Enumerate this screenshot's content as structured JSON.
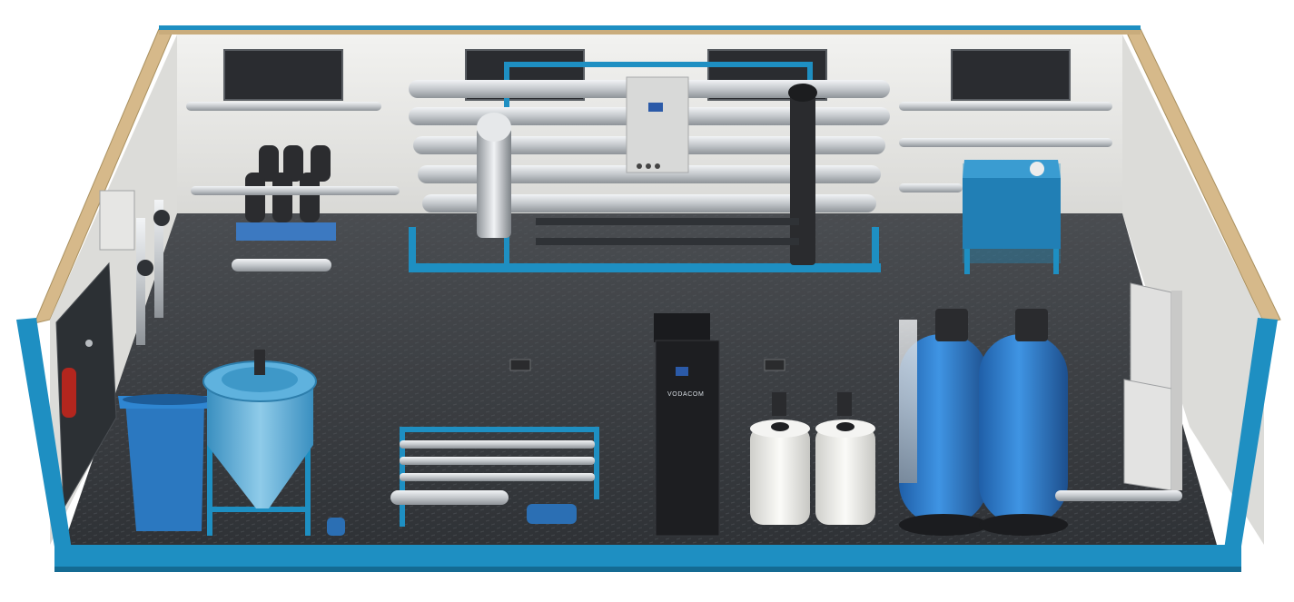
{
  "scene": {
    "brand_label": "VODACOM",
    "colors": {
      "frame_blue": "#1e8fc2",
      "floor": "#3a3d41",
      "wall": "#e9e9e7",
      "tank_blue": "#2f7fd0",
      "cabinet_black": "#1d1e21",
      "pipe_grey": "#c8ccd0",
      "plywood": "#d6b98a"
    }
  }
}
